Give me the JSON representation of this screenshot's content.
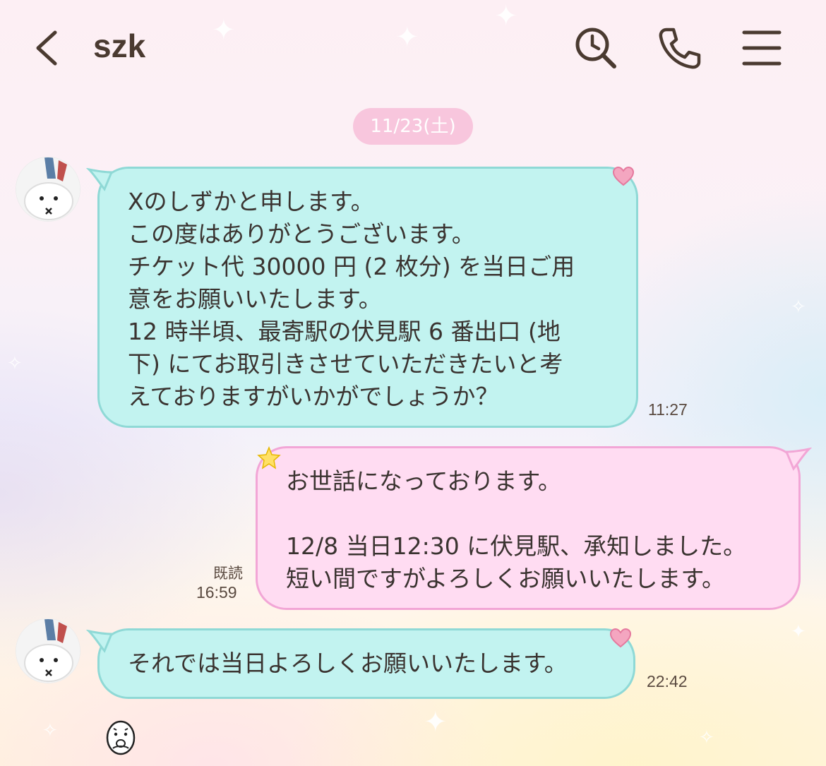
{
  "header": {
    "title": "szk",
    "back_icon": "chevron-left-icon",
    "search_icon": "search-clock-icon",
    "call_icon": "phone-icon",
    "menu_icon": "hamburger-menu-icon"
  },
  "chat": {
    "date_label": "11/23(土)",
    "messages": [
      {
        "direction": "incoming",
        "lines": [
          "Xのしずかと申します。",
          "この度はありがとうございます。",
          "チケット代 30000 円 (2 枚分) を当日ご用",
          "意をお願いいたします。",
          "12 時半頃、最寄駅の伏見駅 6 番出口 (地",
          "下) にてお取引きさせていただきたいと考",
          "えておりますがいかがでしょうか？"
        ],
        "time": "11:27"
      },
      {
        "direction": "outgoing",
        "lines": [
          "お世話になっております。",
          "",
          "12/8 当日12:30 に伏見駅、承知しました。",
          "短い間ですがよろしくお願いいたします。"
        ],
        "read_label": "既読",
        "time": "16:59"
      },
      {
        "direction": "incoming",
        "lines": [
          "それでは当日よろしくお願いいたします。"
        ],
        "time": "22:42"
      }
    ]
  },
  "colors": {
    "incoming_bubble": "#c2f3f0",
    "outgoing_bubble": "#ffdcf2",
    "date_pill": "#f8c6dd",
    "header_text": "#4a3a30"
  }
}
